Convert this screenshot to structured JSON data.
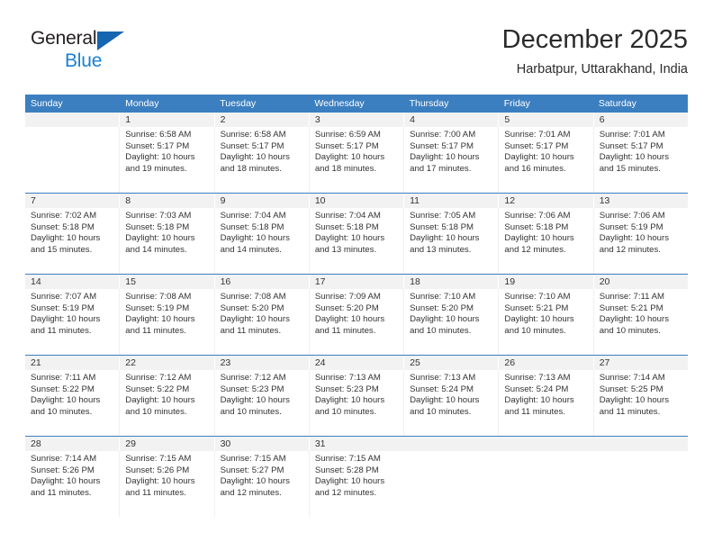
{
  "brand": {
    "name_part1": "General",
    "name_part2": "Blue",
    "triangle_color": "#1565b0",
    "blue_color": "#1a7fd4"
  },
  "header": {
    "title": "December 2025",
    "subtitle": "Harbatpur, Uttarakhand, India"
  },
  "theme": {
    "header_blue": "#3c7fc0",
    "number_band": "#f2f2f2",
    "text": "#333333"
  },
  "weekdays": [
    "Sunday",
    "Monday",
    "Tuesday",
    "Wednesday",
    "Thursday",
    "Friday",
    "Saturday"
  ],
  "weeks": [
    {
      "days": [
        {
          "date": "",
          "sunrise": "",
          "sunset": "",
          "daylight_1": "",
          "daylight_2": "",
          "empty": true
        },
        {
          "date": "1",
          "sunrise": "Sunrise: 6:58 AM",
          "sunset": "Sunset: 5:17 PM",
          "daylight_1": "Daylight: 10 hours",
          "daylight_2": "and 19 minutes.",
          "empty": false
        },
        {
          "date": "2",
          "sunrise": "Sunrise: 6:58 AM",
          "sunset": "Sunset: 5:17 PM",
          "daylight_1": "Daylight: 10 hours",
          "daylight_2": "and 18 minutes.",
          "empty": false
        },
        {
          "date": "3",
          "sunrise": "Sunrise: 6:59 AM",
          "sunset": "Sunset: 5:17 PM",
          "daylight_1": "Daylight: 10 hours",
          "daylight_2": "and 18 minutes.",
          "empty": false
        },
        {
          "date": "4",
          "sunrise": "Sunrise: 7:00 AM",
          "sunset": "Sunset: 5:17 PM",
          "daylight_1": "Daylight: 10 hours",
          "daylight_2": "and 17 minutes.",
          "empty": false
        },
        {
          "date": "5",
          "sunrise": "Sunrise: 7:01 AM",
          "sunset": "Sunset: 5:17 PM",
          "daylight_1": "Daylight: 10 hours",
          "daylight_2": "and 16 minutes.",
          "empty": false
        },
        {
          "date": "6",
          "sunrise": "Sunrise: 7:01 AM",
          "sunset": "Sunset: 5:17 PM",
          "daylight_1": "Daylight: 10 hours",
          "daylight_2": "and 15 minutes.",
          "empty": false
        }
      ]
    },
    {
      "days": [
        {
          "date": "7",
          "sunrise": "Sunrise: 7:02 AM",
          "sunset": "Sunset: 5:18 PM",
          "daylight_1": "Daylight: 10 hours",
          "daylight_2": "and 15 minutes.",
          "empty": false
        },
        {
          "date": "8",
          "sunrise": "Sunrise: 7:03 AM",
          "sunset": "Sunset: 5:18 PM",
          "daylight_1": "Daylight: 10 hours",
          "daylight_2": "and 14 minutes.",
          "empty": false
        },
        {
          "date": "9",
          "sunrise": "Sunrise: 7:04 AM",
          "sunset": "Sunset: 5:18 PM",
          "daylight_1": "Daylight: 10 hours",
          "daylight_2": "and 14 minutes.",
          "empty": false
        },
        {
          "date": "10",
          "sunrise": "Sunrise: 7:04 AM",
          "sunset": "Sunset: 5:18 PM",
          "daylight_1": "Daylight: 10 hours",
          "daylight_2": "and 13 minutes.",
          "empty": false
        },
        {
          "date": "11",
          "sunrise": "Sunrise: 7:05 AM",
          "sunset": "Sunset: 5:18 PM",
          "daylight_1": "Daylight: 10 hours",
          "daylight_2": "and 13 minutes.",
          "empty": false
        },
        {
          "date": "12",
          "sunrise": "Sunrise: 7:06 AM",
          "sunset": "Sunset: 5:18 PM",
          "daylight_1": "Daylight: 10 hours",
          "daylight_2": "and 12 minutes.",
          "empty": false
        },
        {
          "date": "13",
          "sunrise": "Sunrise: 7:06 AM",
          "sunset": "Sunset: 5:19 PM",
          "daylight_1": "Daylight: 10 hours",
          "daylight_2": "and 12 minutes.",
          "empty": false
        }
      ]
    },
    {
      "days": [
        {
          "date": "14",
          "sunrise": "Sunrise: 7:07 AM",
          "sunset": "Sunset: 5:19 PM",
          "daylight_1": "Daylight: 10 hours",
          "daylight_2": "and 11 minutes.",
          "empty": false
        },
        {
          "date": "15",
          "sunrise": "Sunrise: 7:08 AM",
          "sunset": "Sunset: 5:19 PM",
          "daylight_1": "Daylight: 10 hours",
          "daylight_2": "and 11 minutes.",
          "empty": false
        },
        {
          "date": "16",
          "sunrise": "Sunrise: 7:08 AM",
          "sunset": "Sunset: 5:20 PM",
          "daylight_1": "Daylight: 10 hours",
          "daylight_2": "and 11 minutes.",
          "empty": false
        },
        {
          "date": "17",
          "sunrise": "Sunrise: 7:09 AM",
          "sunset": "Sunset: 5:20 PM",
          "daylight_1": "Daylight: 10 hours",
          "daylight_2": "and 11 minutes.",
          "empty": false
        },
        {
          "date": "18",
          "sunrise": "Sunrise: 7:10 AM",
          "sunset": "Sunset: 5:20 PM",
          "daylight_1": "Daylight: 10 hours",
          "daylight_2": "and 10 minutes.",
          "empty": false
        },
        {
          "date": "19",
          "sunrise": "Sunrise: 7:10 AM",
          "sunset": "Sunset: 5:21 PM",
          "daylight_1": "Daylight: 10 hours",
          "daylight_2": "and 10 minutes.",
          "empty": false
        },
        {
          "date": "20",
          "sunrise": "Sunrise: 7:11 AM",
          "sunset": "Sunset: 5:21 PM",
          "daylight_1": "Daylight: 10 hours",
          "daylight_2": "and 10 minutes.",
          "empty": false
        }
      ]
    },
    {
      "days": [
        {
          "date": "21",
          "sunrise": "Sunrise: 7:11 AM",
          "sunset": "Sunset: 5:22 PM",
          "daylight_1": "Daylight: 10 hours",
          "daylight_2": "and 10 minutes.",
          "empty": false
        },
        {
          "date": "22",
          "sunrise": "Sunrise: 7:12 AM",
          "sunset": "Sunset: 5:22 PM",
          "daylight_1": "Daylight: 10 hours",
          "daylight_2": "and 10 minutes.",
          "empty": false
        },
        {
          "date": "23",
          "sunrise": "Sunrise: 7:12 AM",
          "sunset": "Sunset: 5:23 PM",
          "daylight_1": "Daylight: 10 hours",
          "daylight_2": "and 10 minutes.",
          "empty": false
        },
        {
          "date": "24",
          "sunrise": "Sunrise: 7:13 AM",
          "sunset": "Sunset: 5:23 PM",
          "daylight_1": "Daylight: 10 hours",
          "daylight_2": "and 10 minutes.",
          "empty": false
        },
        {
          "date": "25",
          "sunrise": "Sunrise: 7:13 AM",
          "sunset": "Sunset: 5:24 PM",
          "daylight_1": "Daylight: 10 hours",
          "daylight_2": "and 10 minutes.",
          "empty": false
        },
        {
          "date": "26",
          "sunrise": "Sunrise: 7:13 AM",
          "sunset": "Sunset: 5:24 PM",
          "daylight_1": "Daylight: 10 hours",
          "daylight_2": "and 11 minutes.",
          "empty": false
        },
        {
          "date": "27",
          "sunrise": "Sunrise: 7:14 AM",
          "sunset": "Sunset: 5:25 PM",
          "daylight_1": "Daylight: 10 hours",
          "daylight_2": "and 11 minutes.",
          "empty": false
        }
      ]
    },
    {
      "days": [
        {
          "date": "28",
          "sunrise": "Sunrise: 7:14 AM",
          "sunset": "Sunset: 5:26 PM",
          "daylight_1": "Daylight: 10 hours",
          "daylight_2": "and 11 minutes.",
          "empty": false
        },
        {
          "date": "29",
          "sunrise": "Sunrise: 7:15 AM",
          "sunset": "Sunset: 5:26 PM",
          "daylight_1": "Daylight: 10 hours",
          "daylight_2": "and 11 minutes.",
          "empty": false
        },
        {
          "date": "30",
          "sunrise": "Sunrise: 7:15 AM",
          "sunset": "Sunset: 5:27 PM",
          "daylight_1": "Daylight: 10 hours",
          "daylight_2": "and 12 minutes.",
          "empty": false
        },
        {
          "date": "31",
          "sunrise": "Sunrise: 7:15 AM",
          "sunset": "Sunset: 5:28 PM",
          "daylight_1": "Daylight: 10 hours",
          "daylight_2": "and 12 minutes.",
          "empty": false
        },
        {
          "date": "",
          "sunrise": "",
          "sunset": "",
          "daylight_1": "",
          "daylight_2": "",
          "empty": true
        },
        {
          "date": "",
          "sunrise": "",
          "sunset": "",
          "daylight_1": "",
          "daylight_2": "",
          "empty": true
        },
        {
          "date": "",
          "sunrise": "",
          "sunset": "",
          "daylight_1": "",
          "daylight_2": "",
          "empty": true
        }
      ]
    }
  ]
}
